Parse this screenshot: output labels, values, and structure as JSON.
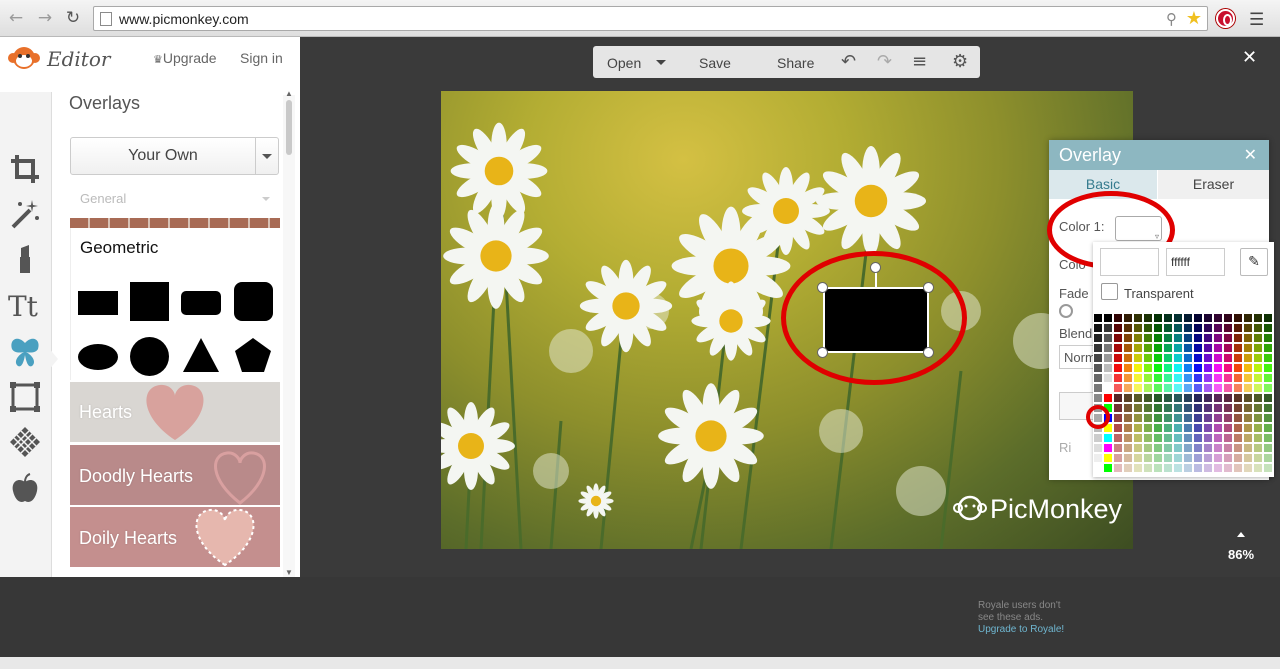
{
  "browser": {
    "url": "www.picmonkey.com",
    "back_icon": "arrow-left-icon",
    "forward_icon": "arrow-right-icon",
    "reload_icon": "reload-icon"
  },
  "app": {
    "editor_label": "Editor",
    "upgrade_label": "Upgrade",
    "signin_label": "Sign in"
  },
  "sidebar": {
    "section_title": "Overlays",
    "dropdown_value": "Your Own",
    "category_filter": "General",
    "geometric_title": "Geometric",
    "categories": [
      {
        "label": "Hearts"
      },
      {
        "label": "Doodly Hearts"
      },
      {
        "label": "Doily Hearts"
      }
    ]
  },
  "topbar": {
    "open_label": "Open",
    "save_label": "Save",
    "share_label": "Share"
  },
  "canvas": {
    "watermark": "PicMonkey",
    "zoom": "86%"
  },
  "overlay_panel": {
    "title": "Overlay",
    "tab_basic": "Basic",
    "tab_eraser": "Eraser",
    "color1_label": "Color 1:",
    "color2_label": "Colo",
    "fade_label": "Fade",
    "blend_label": "Blend",
    "blend_value": "Norm",
    "reset_label": "Ri"
  },
  "color_picker": {
    "hex_value": "ffffff",
    "transparent_label": "Transparent"
  },
  "ad": {
    "line1": "Royale users don't",
    "line2": "see these ads.",
    "link": "Upgrade to Royale!"
  },
  "colors": {
    "accent": "#8db7c1",
    "highlight": "#e00000"
  }
}
